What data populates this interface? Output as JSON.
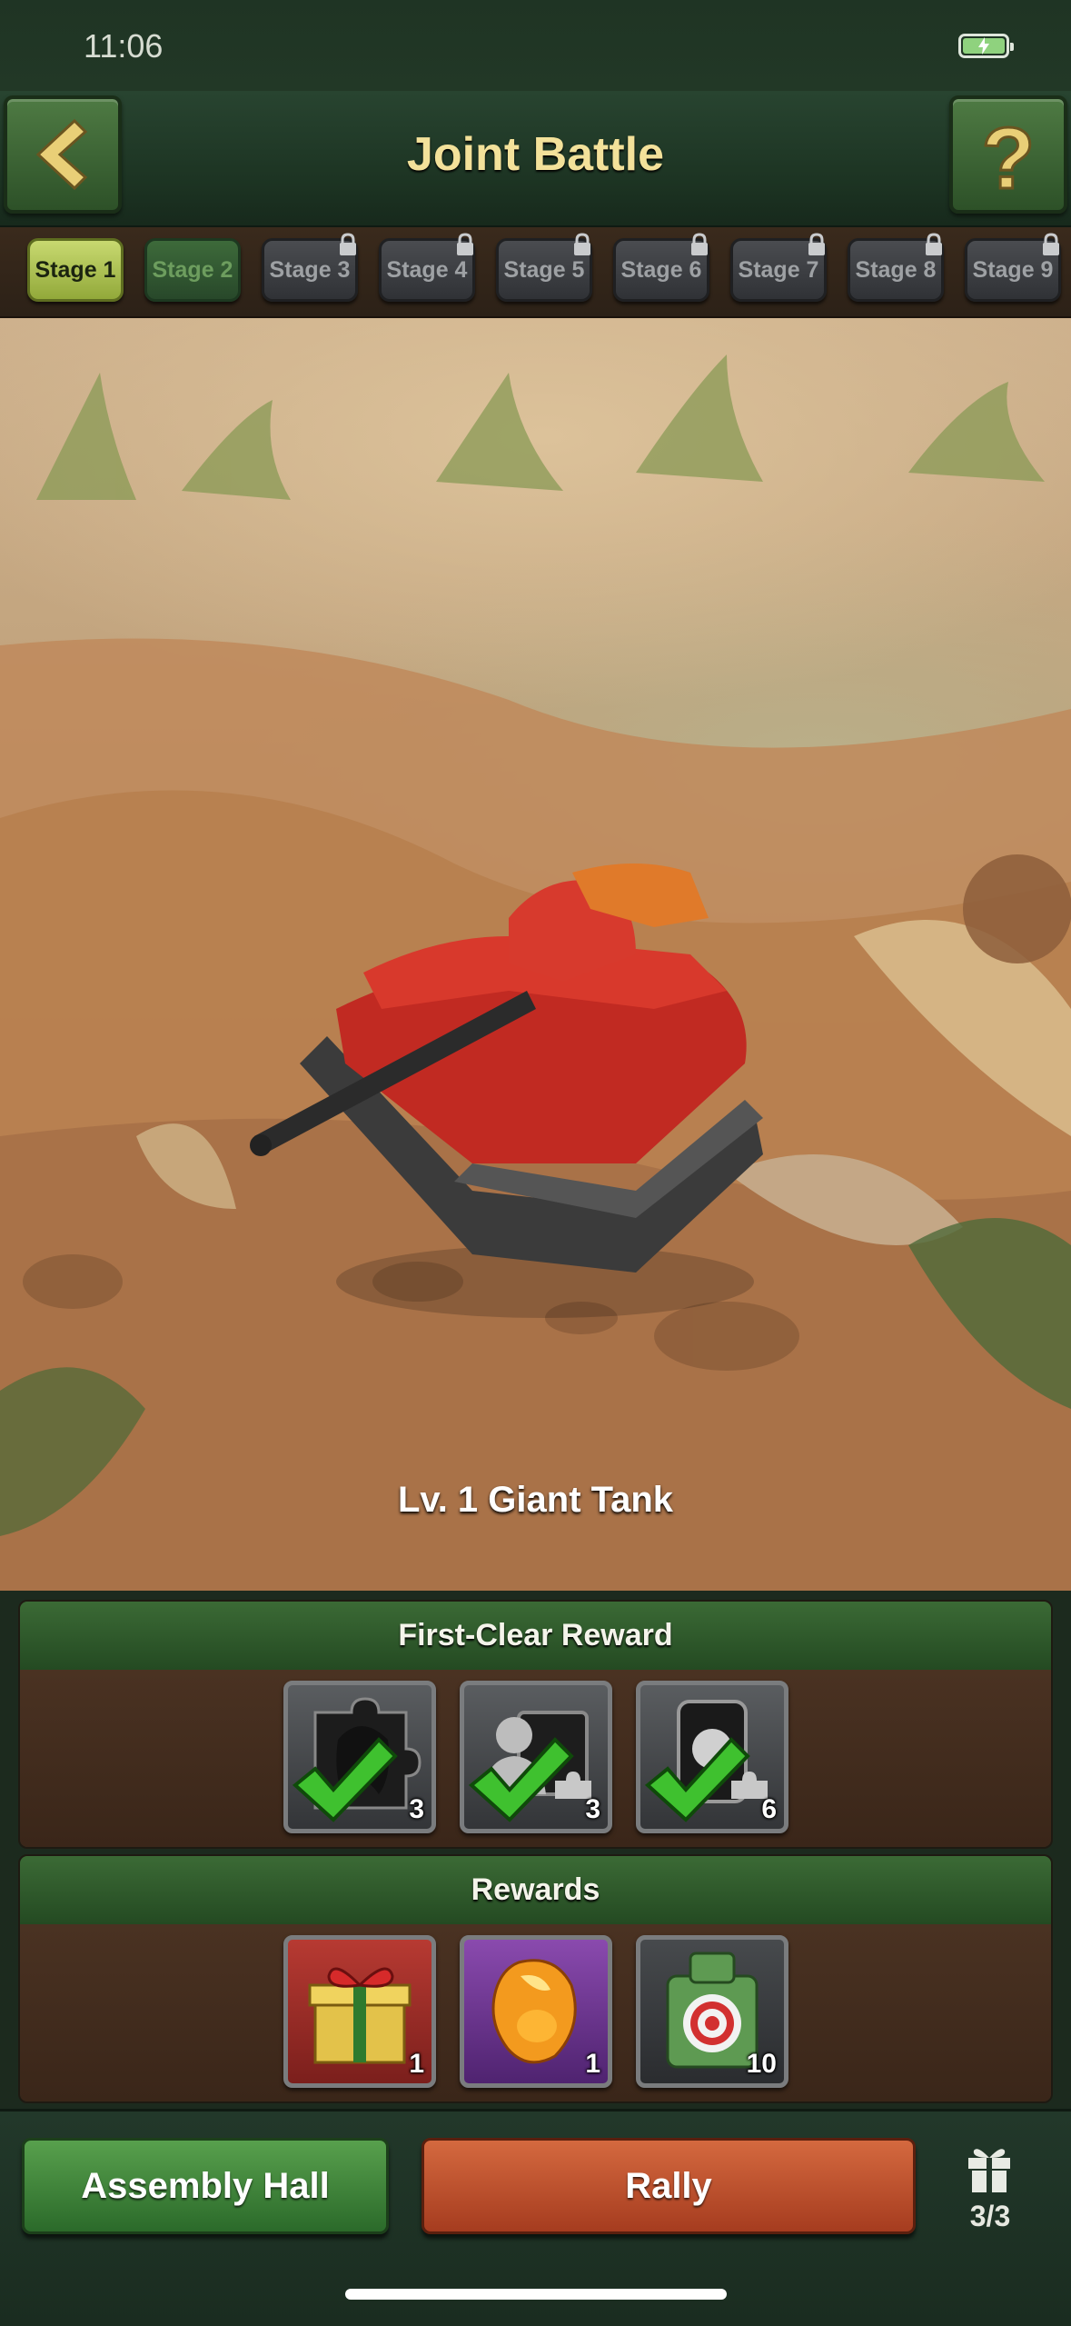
{
  "status_bar": {
    "time": "11:06",
    "battery_icon": "battery-charging-icon"
  },
  "header": {
    "title": "Joint Battle",
    "back_icon": "back-arrow-icon",
    "help_icon": "question-mark-icon",
    "title_color": "#f3e19a"
  },
  "stages": [
    {
      "label": "Stage 1",
      "state": "active"
    },
    {
      "label": "Stage 2",
      "state": "open"
    },
    {
      "label": "Stage 3",
      "state": "locked"
    },
    {
      "label": "Stage 4",
      "state": "locked"
    },
    {
      "label": "Stage 5",
      "state": "locked"
    },
    {
      "label": "Stage 6",
      "state": "locked"
    },
    {
      "label": "Stage 7",
      "state": "locked"
    },
    {
      "label": "Stage 8",
      "state": "locked"
    },
    {
      "label": "Stage 9",
      "state": "locked"
    }
  ],
  "scene": {
    "unit_label": "Lv. 1 Giant Tank",
    "unit_icon": "red-tank-icon"
  },
  "first_clear_reward": {
    "title": "First-Clear Reward",
    "items": [
      {
        "icon": "hero-puzzle-piece-icon",
        "count": "3",
        "claimed": true
      },
      {
        "icon": "portrait-fragment-icon",
        "count": "3",
        "claimed": true
      },
      {
        "icon": "device-fragment-icon",
        "count": "6",
        "claimed": true
      }
    ]
  },
  "rewards": {
    "title": "Rewards",
    "items": [
      {
        "icon": "gift-box-icon",
        "count": "1"
      },
      {
        "icon": "amber-gem-icon",
        "count": "1"
      },
      {
        "icon": "target-robot-icon",
        "count": "10"
      }
    ]
  },
  "bottom": {
    "assembly_label": "Assembly Hall",
    "rally_label": "Rally",
    "gift_icon": "gift-icon",
    "gift_count": "3/3",
    "rally_color": "#c2552f",
    "assembly_color": "#3f8138"
  }
}
